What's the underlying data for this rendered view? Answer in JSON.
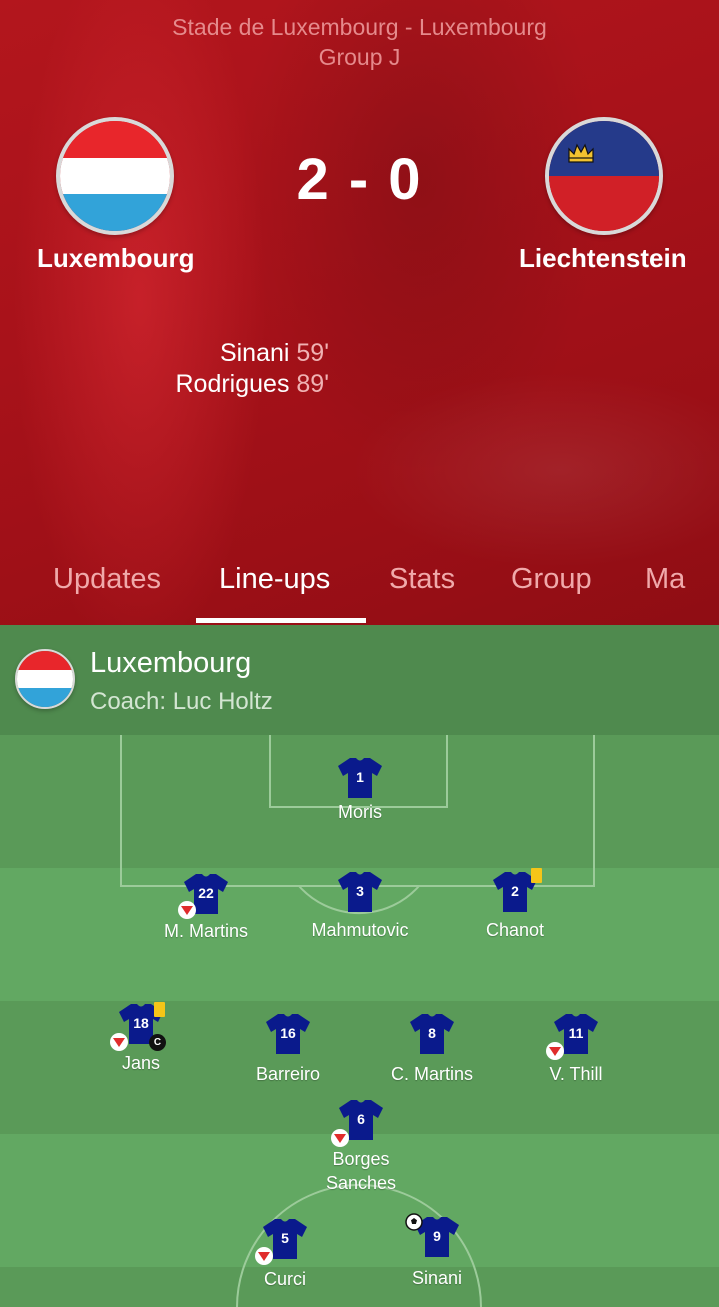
{
  "match": {
    "venue_line1": "Stade de Luxembourg  -  Luxembourg",
    "venue_line2": "Group J",
    "home_team": "Luxembourg",
    "away_team": "Liechtenstein",
    "score": "2 - 0",
    "scorers": [
      {
        "name": "Sinani",
        "minute": "59'"
      },
      {
        "name": "Rodrigues",
        "minute": "89'"
      }
    ]
  },
  "tabs": [
    {
      "label": "Updates",
      "active": false
    },
    {
      "label": "Line-ups",
      "active": true
    },
    {
      "label": "Stats",
      "active": false
    },
    {
      "label": "Group",
      "active": false
    },
    {
      "label": "Ma",
      "active": false
    }
  ],
  "lineup": {
    "team_name": "Luxembourg",
    "coach": "Coach: Luc Holtz",
    "shirt_color": "#0a1a8c",
    "players": [
      {
        "number": "1",
        "name": "Moris",
        "subbed_off": false,
        "yellow_card": false,
        "captain": false,
        "scored": false
      },
      {
        "number": "22",
        "name": "M. Martins",
        "subbed_off": true,
        "yellow_card": false,
        "captain": false,
        "scored": false
      },
      {
        "number": "3",
        "name": "Mahmutovic",
        "subbed_off": false,
        "yellow_card": false,
        "captain": false,
        "scored": false
      },
      {
        "number": "2",
        "name": "Chanot",
        "subbed_off": false,
        "yellow_card": true,
        "captain": false,
        "scored": false
      },
      {
        "number": "18",
        "name": "Jans",
        "subbed_off": true,
        "yellow_card": true,
        "captain": true,
        "scored": false
      },
      {
        "number": "16",
        "name": "Barreiro",
        "subbed_off": false,
        "yellow_card": false,
        "captain": false,
        "scored": false
      },
      {
        "number": "8",
        "name": "C. Martins",
        "subbed_off": false,
        "yellow_card": false,
        "captain": false,
        "scored": false
      },
      {
        "number": "11",
        "name": "V. Thill",
        "subbed_off": true,
        "yellow_card": false,
        "captain": false,
        "scored": false
      },
      {
        "number": "6",
        "name_line1": "Borges",
        "name_line2": "Sanches",
        "subbed_off": true,
        "yellow_card": false,
        "captain": false,
        "scored": false
      },
      {
        "number": "5",
        "name": "Curci",
        "subbed_off": true,
        "yellow_card": false,
        "captain": false,
        "scored": false
      },
      {
        "number": "9",
        "name": "Sinani",
        "subbed_off": false,
        "yellow_card": false,
        "captain": false,
        "scored": true
      }
    ],
    "captain_mark": "C"
  },
  "colors": {
    "header_red": "#a8121a",
    "pitch_light": "#62a862",
    "pitch_dark": "#5a9a58",
    "yellow_card": "#f5c518",
    "sub_arrow": "#e02c2c"
  }
}
